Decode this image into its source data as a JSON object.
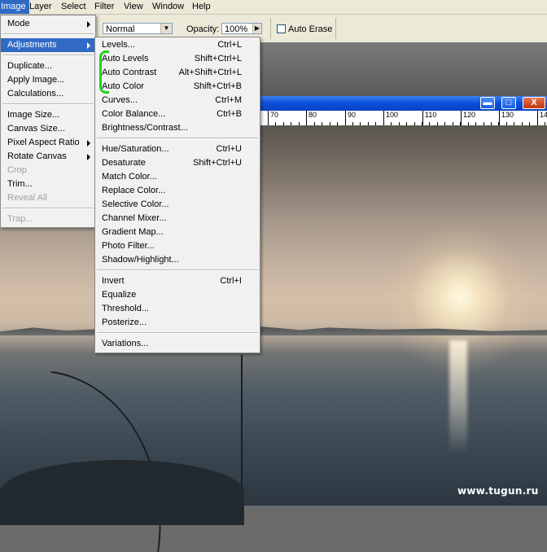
{
  "menubar": {
    "items": [
      "Image",
      "Layer",
      "Select",
      "Filter",
      "View",
      "Window",
      "Help"
    ]
  },
  "options": {
    "mode_value": "Normal",
    "opacity_label": "Opacity:",
    "opacity_value": "100%",
    "auto_erase_label": "Auto Erase"
  },
  "image_menu": {
    "items": [
      {
        "label": "Mode",
        "sub": true
      },
      {
        "label": "Adjustments",
        "sub": true
      },
      {
        "label": "Duplicate..."
      },
      {
        "label": "Apply Image..."
      },
      {
        "label": "Calculations..."
      },
      {
        "label": "Image Size..."
      },
      {
        "label": "Canvas Size..."
      },
      {
        "label": "Pixel Aspect Ratio",
        "sub": true
      },
      {
        "label": "Rotate Canvas",
        "sub": true
      },
      {
        "label": "Crop"
      },
      {
        "label": "Trim..."
      },
      {
        "label": "Reveal All"
      },
      {
        "label": "Trap..."
      }
    ]
  },
  "adjustments_menu": {
    "items": [
      {
        "label": "Levels...",
        "shortcut": "Ctrl+L"
      },
      {
        "label": "Auto Levels",
        "shortcut": "Shift+Ctrl+L"
      },
      {
        "label": "Auto Contrast",
        "shortcut": "Alt+Shift+Ctrl+L"
      },
      {
        "label": "Auto Color",
        "shortcut": "Shift+Ctrl+B"
      },
      {
        "label": "Curves...",
        "shortcut": "Ctrl+M"
      },
      {
        "label": "Color Balance...",
        "shortcut": "Ctrl+B"
      },
      {
        "label": "Brightness/Contrast...",
        "shortcut": ""
      },
      {
        "label": "Hue/Saturation...",
        "shortcut": "Ctrl+U"
      },
      {
        "label": "Desaturate",
        "shortcut": "Shift+Ctrl+U"
      },
      {
        "label": "Match Color...",
        "shortcut": ""
      },
      {
        "label": "Replace Color...",
        "shortcut": ""
      },
      {
        "label": "Selective Color...",
        "shortcut": ""
      },
      {
        "label": "Channel Mixer...",
        "shortcut": ""
      },
      {
        "label": "Gradient Map...",
        "shortcut": ""
      },
      {
        "label": "Photo Filter...",
        "shortcut": ""
      },
      {
        "label": "Shadow/Highlight...",
        "shortcut": ""
      },
      {
        "label": "Invert",
        "shortcut": "Ctrl+I"
      },
      {
        "label": "Equalize",
        "shortcut": ""
      },
      {
        "label": "Threshold...",
        "shortcut": ""
      },
      {
        "label": "Posterize...",
        "shortcut": ""
      },
      {
        "label": "Variations...",
        "shortcut": ""
      }
    ]
  },
  "ruler": {
    "ticks": [
      "70",
      "80",
      "90",
      "100",
      "110",
      "120",
      "130",
      "14"
    ]
  },
  "window_buttons": {
    "minimize": "▬",
    "maximize": "□",
    "close": "X"
  },
  "watermark": "www.tugun.ru",
  "colors": {
    "menu_highlight": "#316ac5",
    "annotation_bracket": "#1fd31f",
    "titlebar": "#0a4fd8"
  }
}
